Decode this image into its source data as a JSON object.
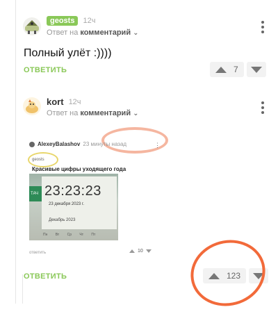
{
  "comment1": {
    "author": "geosts",
    "time": "12ч",
    "reply_prefix": "Ответ на",
    "reply_target": "комментарий",
    "text": "Полный улёт :))))",
    "reply_button": "ОТВЕТИТЬ",
    "votes": "7"
  },
  "comment2": {
    "author": "kort",
    "time": "12ч",
    "reply_prefix": "Ответ на",
    "reply_target": "комментарий",
    "reply_button": "ОТВЕТИТЬ",
    "votes": "123",
    "embedded": {
      "author": "AlexeyBalashov",
      "time": "23 минуты назад",
      "sub_author": "geosts",
      "title": "Красивые цифры уходящего года",
      "clock": "23:23:23",
      "date": "23 декабря 2023 г.",
      "month": "Декабрь 2023",
      "weekdays": "Пн Вт Ср Чт Пт",
      "reply_button": "ответить",
      "votes": "10"
    }
  },
  "colors": {
    "accent": "#8ac858",
    "highlight": "#f26a3a"
  }
}
